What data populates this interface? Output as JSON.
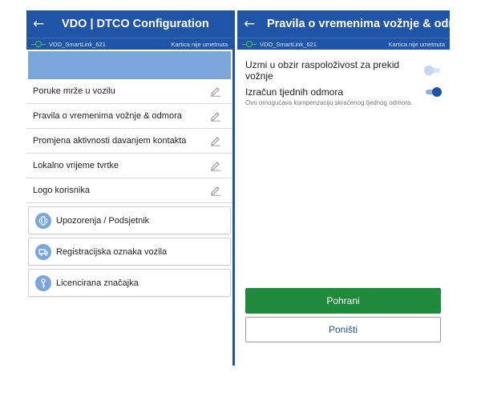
{
  "left": {
    "title": "VDO | DTCO Configuration",
    "device_name": "VDO_SmartLink_621",
    "card_status": "Kartica nije umetnuta",
    "menu_items": [
      {
        "label": "Poruke mrže u vozilu"
      },
      {
        "label": "Pravila o vremenima vožnje & odmora"
      },
      {
        "label": "Promjena aktivnosti davanjem kontakta"
      },
      {
        "label": "Lokalno vrijeme tvrtke"
      },
      {
        "label": "Logo korisnika"
      }
    ],
    "cards": [
      {
        "label": "Upozorenja / Podsjetnik",
        "icon": "vibration-phone-icon"
      },
      {
        "label": "Registracijska oznaka vozila",
        "icon": "truck-icon"
      },
      {
        "label": "Licencirana značajka",
        "icon": "key-icon"
      }
    ]
  },
  "right": {
    "title": "Pravila o vremenima vožnje & odm",
    "device_name": "VDO_SmartLink_621",
    "card_status": "Kartica nije umetnuta",
    "setting_1": {
      "label": "Uzmi u obzir raspoloživost za prekid vožnje",
      "enabled": false
    },
    "setting_2": {
      "label": "Izračun tjednih odmora",
      "enabled": true
    },
    "hint": "Ovo omogućava kompenzaciju skraćenog tjednog odmora.",
    "save_label": "Pohrani",
    "cancel_label": "Poništi"
  },
  "colors": {
    "primary": "#1f54a6",
    "accent_light": "#7aa6dc",
    "save_green": "#1f8a3b",
    "connection_green": "#4cbf4c"
  }
}
